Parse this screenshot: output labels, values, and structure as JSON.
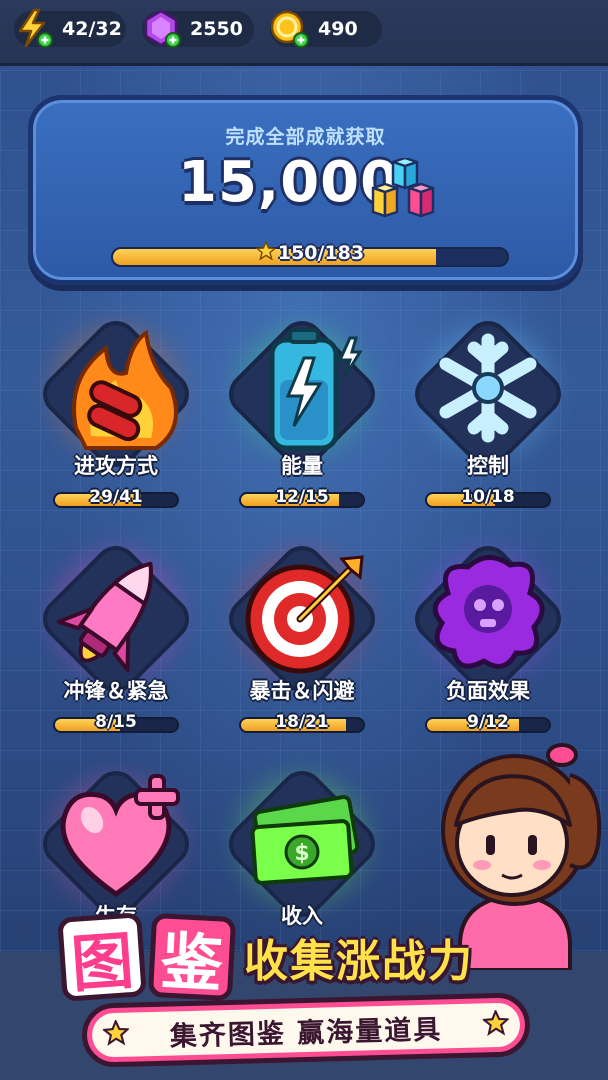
{
  "resources": {
    "energy": {
      "value": "42/32",
      "icon": "lightning-icon",
      "color": "#ffd23a"
    },
    "gems": {
      "value": "2550",
      "icon": "purple-gem-icon",
      "color": "#b24ae8"
    },
    "coins": {
      "value": "490",
      "icon": "gold-coin-icon",
      "color": "#ffc21a"
    }
  },
  "banner": {
    "title": "完成全部成就获取",
    "amount": "15,000",
    "reward_icon": "colored-cubes-icon",
    "progress_label": "150/183",
    "progress_current": 150,
    "progress_total": 183
  },
  "achievements": [
    {
      "label": "进攻方式",
      "progress": "29/41",
      "current": 29,
      "total": 41,
      "icon": "flaming-bullets-icon",
      "glow": "#ff7a1a"
    },
    {
      "label": "能量",
      "progress": "12/15",
      "current": 12,
      "total": 15,
      "icon": "battery-lightning-icon",
      "glow": "#3ef07a"
    },
    {
      "label": "控制",
      "progress": "10/18",
      "current": 10,
      "total": 18,
      "icon": "snowflake-icon",
      "glow": "#6fd0ff"
    },
    {
      "label": "冲锋＆紧急",
      "progress": "8/15",
      "current": 8,
      "total": 15,
      "icon": "rocket-icon",
      "glow": "#ff4ac8"
    },
    {
      "label": "暴击＆闪避",
      "progress": "18/21",
      "current": 18,
      "total": 21,
      "icon": "target-arrow-icon",
      "glow": "#ff3a3a"
    },
    {
      "label": "负面效果",
      "progress": "9/12",
      "current": 9,
      "total": 12,
      "icon": "toxic-skull-icon",
      "glow": "#c04aff"
    },
    {
      "label": "生存",
      "icon": "heart-plus-icon",
      "glow": "#ff5aa8"
    },
    {
      "label": "收入",
      "icon": "cash-stack-icon",
      "glow": "#7aff4a"
    }
  ],
  "promo": {
    "char1": "图",
    "char2": "鉴",
    "headline_rest": "收集涨战力",
    "subline": "集齐图鉴 赢海量道具"
  }
}
